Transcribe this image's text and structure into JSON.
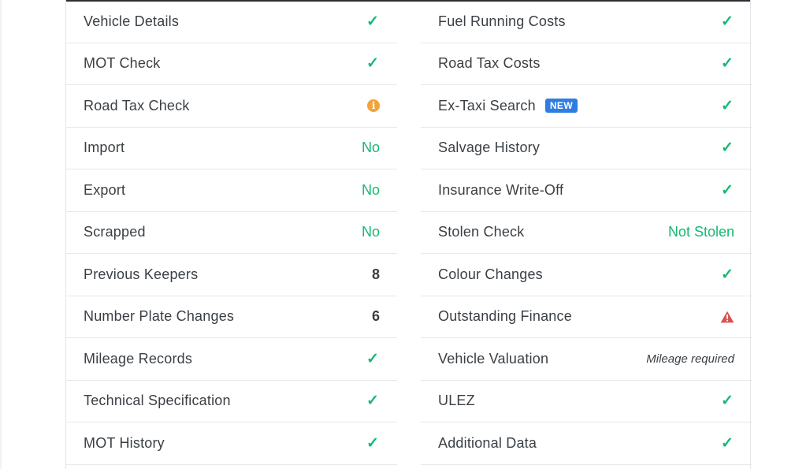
{
  "colors": {
    "green": "#16b872",
    "warning": "#d9534f",
    "info": "#f0a43a",
    "badge": "#2f7de1"
  },
  "left_rows": [
    {
      "label": "Vehicle Details",
      "icon": "check-icon"
    },
    {
      "label": "MOT Check",
      "icon": "check-icon"
    },
    {
      "label": "Road Tax Check",
      "icon": "info-icon"
    },
    {
      "label": "Import",
      "value": "No"
    },
    {
      "label": "Export",
      "value": "No"
    },
    {
      "label": "Scrapped",
      "value": "No"
    },
    {
      "label": "Previous Keepers",
      "value": "8"
    },
    {
      "label": "Number Plate Changes",
      "value": "6"
    },
    {
      "label": "Mileage Records",
      "icon": "check-icon"
    },
    {
      "label": "Technical Specification",
      "icon": "check-icon"
    },
    {
      "label": "MOT History",
      "icon": "check-icon"
    }
  ],
  "right_rows": [
    {
      "label": "Fuel Running Costs",
      "icon": "check-icon"
    },
    {
      "label": "Road Tax Costs",
      "icon": "check-icon"
    },
    {
      "label": "Ex-Taxi Search",
      "badge": "NEW",
      "icon": "check-icon"
    },
    {
      "label": "Salvage History",
      "icon": "check-icon"
    },
    {
      "label": "Insurance Write-Off",
      "icon": "check-icon"
    },
    {
      "label": "Stolen Check",
      "value": "Not Stolen"
    },
    {
      "label": "Colour Changes",
      "icon": "check-icon"
    },
    {
      "label": "Outstanding Finance",
      "icon": "warning-icon"
    },
    {
      "label": "Vehicle Valuation",
      "value": "Mileage required"
    },
    {
      "label": "ULEZ",
      "icon": "check-icon"
    },
    {
      "label": "Additional Data",
      "icon": "check-icon"
    }
  ],
  "check_glyph": "✓",
  "info_glyph": "i"
}
